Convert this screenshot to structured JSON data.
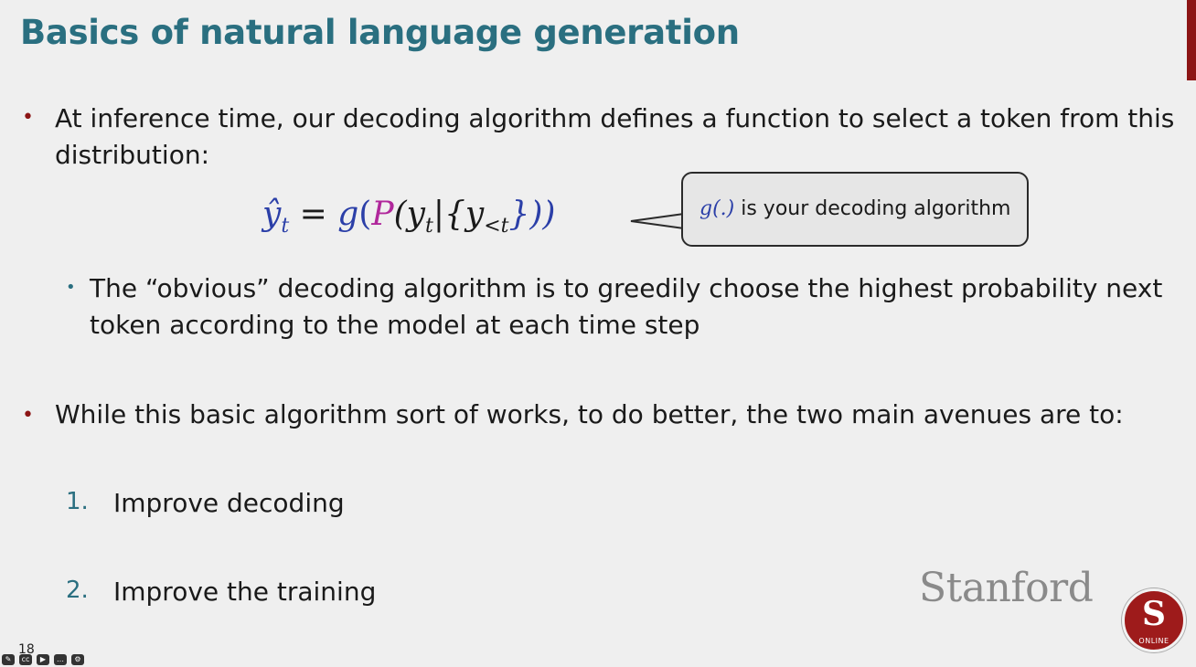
{
  "slide": {
    "title": "Basics of natural language generation",
    "bullet1": {
      "line1": "At inference time, our decoding algorithm defines a function to select a token from this",
      "line2": "distribution:"
    },
    "formula": {
      "yhat": "ŷ",
      "sub_t": "t",
      "eq": " = ",
      "g": "g",
      "open": "(",
      "P": "P",
      "mid": "(y",
      "bar": "|{y",
      "sub_lt": "<t",
      "close": "}))"
    },
    "callout": {
      "g": "g(.)",
      "text": " is your decoding algorithm"
    },
    "sub_bullet": {
      "line1": "The “obvious” decoding algorithm is to greedily choose the highest probability next",
      "line2": "token according to the model at each time step"
    },
    "bullet2": "While this basic algorithm sort of works, to do better, the two main avenues are to:",
    "list": [
      {
        "num": "1.",
        "text": "Improve decoding"
      },
      {
        "num": "2.",
        "text": "Improve the training"
      }
    ],
    "brand": "Stanford",
    "logo_letter": "S",
    "logo_caption": "ONLINE",
    "page_number": "18"
  },
  "colors": {
    "title": "#2a6f80",
    "bullet": "#8c1515",
    "accent_blue": "#2b3fa8",
    "accent_magenta": "#b0279b"
  },
  "icons": [
    "pencil-icon",
    "captions-icon",
    "camera-icon",
    "chat-icon",
    "settings-icon"
  ]
}
